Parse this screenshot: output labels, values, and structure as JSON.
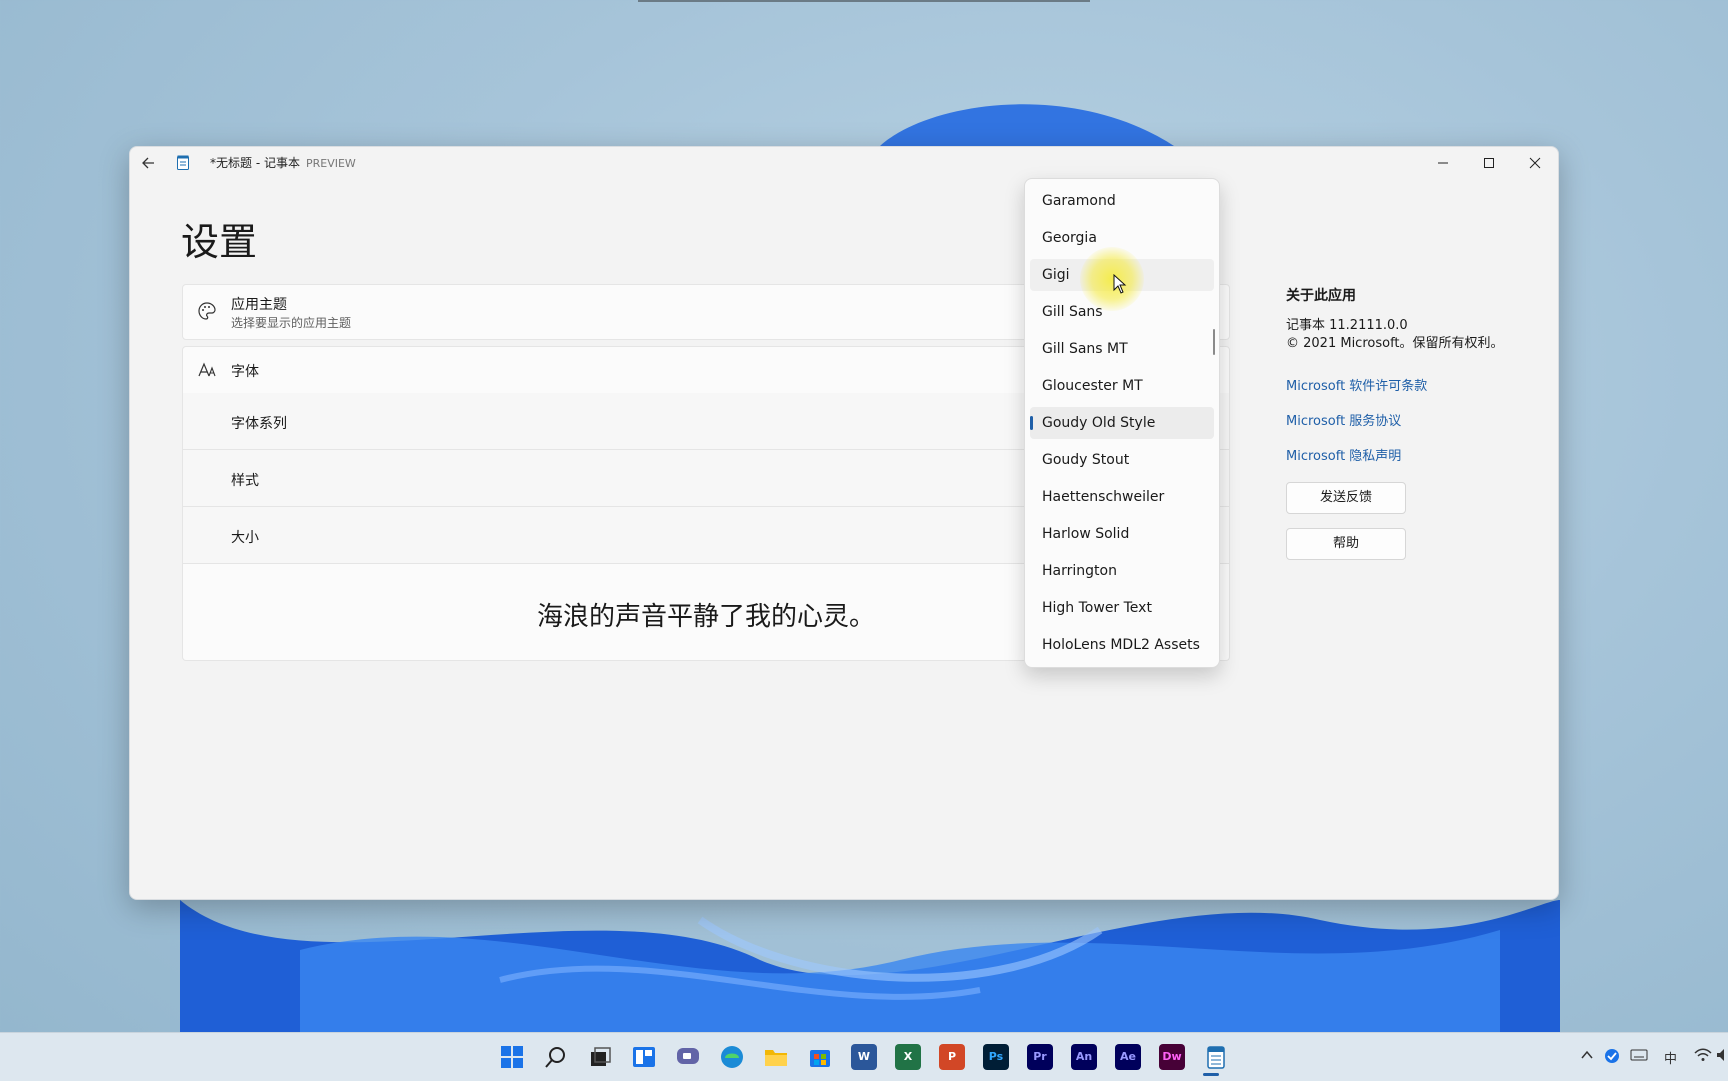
{
  "window": {
    "title": "*无标题 - 记事本",
    "title_tag": "PREVIEW",
    "back_icon": "arrow-left-icon",
    "controls": [
      "minimize-icon",
      "maximize-icon",
      "close-icon"
    ]
  },
  "settings": {
    "page_title": "设置",
    "theme": {
      "label": "应用主题",
      "description": "选择要显示的应用主题",
      "icon": "palette-icon"
    },
    "font": {
      "label": "字体",
      "icon": "font-icon"
    },
    "font_family_label": "字体系列",
    "style_label": "样式",
    "size_label": "大小",
    "preview_text": "海浪的声音平静了我的心灵。"
  },
  "about": {
    "heading": "关于此应用",
    "version": "记事本 11.2111.0.0",
    "copyright": "© 2021 Microsoft。保留所有权利。",
    "links": [
      "Microsoft 软件许可条款",
      "Microsoft 服务协议",
      "Microsoft 隐私声明"
    ],
    "feedback_button": "发送反馈",
    "help_button": "帮助"
  },
  "font_dropdown": {
    "items": [
      "Garamond",
      "Georgia",
      "Gigi",
      "Gill Sans",
      "Gill Sans MT",
      "Gloucester MT",
      "Goudy Old Style",
      "Goudy Stout",
      "Haettenschweiler",
      "Harlow Solid",
      "Harrington",
      "High Tower Text",
      "HoloLens MDL2 Assets"
    ],
    "selected": "Goudy Old Style",
    "hovered": "Gigi",
    "accent_color": "#1f5fa8"
  },
  "taskbar": {
    "apps": [
      "Pr",
      "An",
      "Ae",
      "Dw"
    ],
    "ime_label": "中"
  }
}
